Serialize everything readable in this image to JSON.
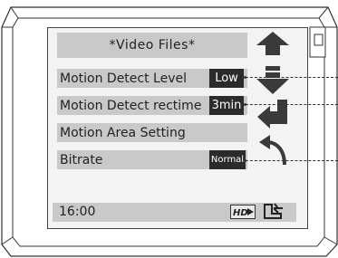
{
  "title": "*Video Files*",
  "menu": [
    {
      "label": "Motion Detect Level",
      "value": "Low"
    },
    {
      "label": "Motion Detect rectime",
      "value": "3min"
    },
    {
      "label": "Motion Area Setting"
    },
    {
      "label": "Bitrate",
      "value": "Normal"
    }
  ],
  "status": {
    "time": "16:00",
    "hd_badge": "HD"
  },
  "icons": {
    "up": "arrow-up-icon",
    "down": "arrow-down-icon",
    "enter": "enter-icon",
    "back": "back-icon",
    "power": "power-plug-icon"
  },
  "colors": {
    "menu_bg": "#c9c9c9",
    "badge_bg": "#2b2b2b",
    "arrow": "#3a3a3a",
    "screen_bg": "#f3f3f3"
  }
}
